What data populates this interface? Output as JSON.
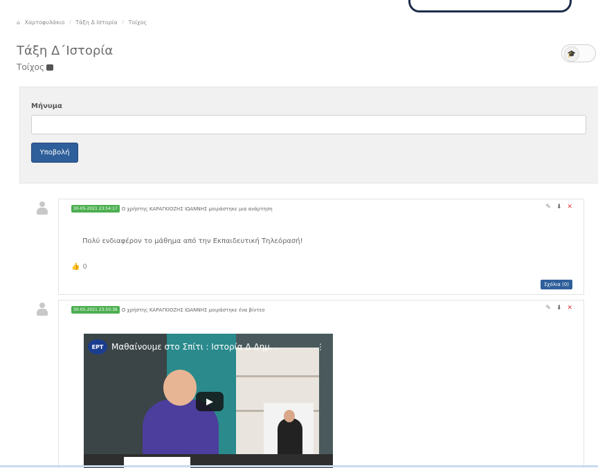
{
  "breadcrumb": [
    "Χαρτοφυλάκιο",
    "Τάξη Δ Ιστορία",
    "Τοίχος"
  ],
  "page": {
    "title": "Τάξη Δ΄Ιστορία",
    "subtitle": "Τοίχος"
  },
  "form": {
    "label": "Μήνυμα",
    "message_value": "",
    "submit_label": "Υποβολή"
  },
  "posts": [
    {
      "date": "30-05-2021 23:54:17",
      "header": "Ο χρήστης ΚΑΡΑΓΚΙΟΖΗΣ ΙΩΑΝΝΗΣ μοιράστηκε μια ανάρτηση",
      "text": "Πολύ ενδιαφέρον το μάθημα από την Εκπαιδευτική Τηλεόρασή!",
      "likes": "0",
      "comments_label": "Σχόλια (0)"
    },
    {
      "date": "30-05-2021 23:50:36",
      "header": "Ο χρήστης ΚΑΡΑΓΚΙΟΖΗΣ ΙΩΑΝΝΗΣ μοιράστηκε ένα βίντεο",
      "video": {
        "channel": "ΕΡΤ",
        "title": "Μαθαίνουμε στο Σπίτι : Ιστορία Δ Δημ..."
      }
    }
  ],
  "icons": {
    "edit": "edit-icon",
    "pin": "pin-icon",
    "delete": "delete-icon",
    "like": "thumbs-up-icon"
  },
  "colors": {
    "primary": "#2f5f9a",
    "date_badge": "#4caf50",
    "delete": "#dd3333"
  }
}
